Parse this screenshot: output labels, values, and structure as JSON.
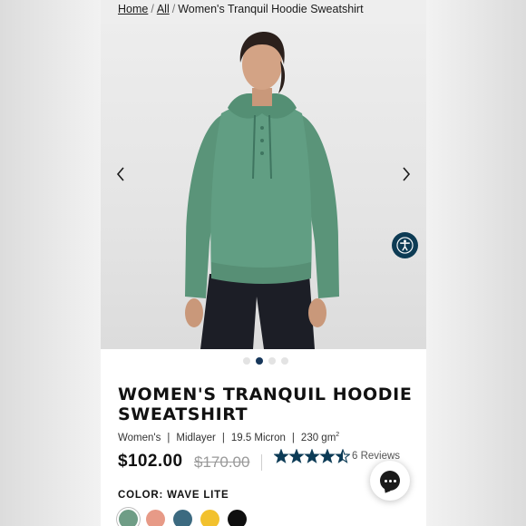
{
  "breadcrumb": {
    "home": "Home",
    "all": "All",
    "current": "Women's Tranquil Hoodie Sweatshirt",
    "separator": "/"
  },
  "gallery": {
    "total_images": 4,
    "active_index": 1,
    "prev_icon": "chevron-left-icon",
    "next_icon": "chevron-right-icon"
  },
  "accessibility_icon": "accessibility-icon",
  "product": {
    "title": "WOMEN'S TRANQUIL HOODIE SWEATSHIRT",
    "specs": [
      "Women's",
      "Midlayer",
      "19.5 Micron",
      "230 gm"
    ],
    "spec_sup": "2",
    "spec_separator": "|",
    "price": "$102.00",
    "compare_price": "$170.00",
    "rating": 4.5,
    "rating_max": 5,
    "reviews": "6 Reviews"
  },
  "color": {
    "label": "COLOR: WAVE LITE",
    "selected_index": 0,
    "swatches": [
      "#6f9d86",
      "#e79a87",
      "#3c6a80",
      "#f2c12e",
      "#0f0f0f"
    ]
  },
  "chat_icon": "chat-bubble-icon",
  "colors": {
    "accent": "#16365a",
    "star": "#0c3b56",
    "hoodie": "#5e9a80"
  }
}
